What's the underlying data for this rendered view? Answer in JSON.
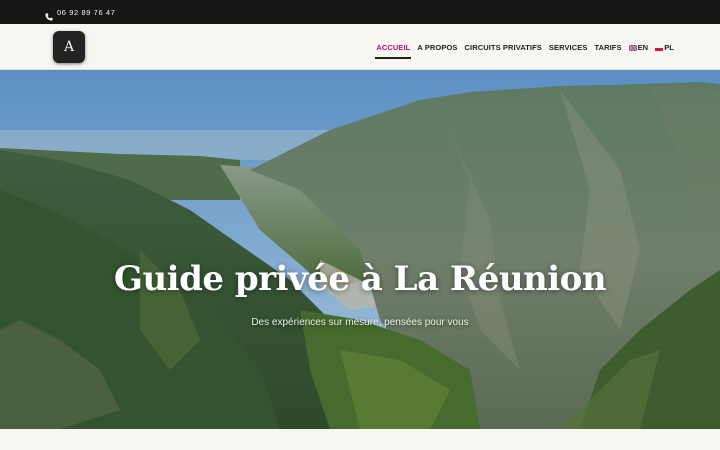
{
  "topbar": {
    "phone": "06 92 89 76 47",
    "icon": "phone-icon"
  },
  "header": {
    "logo_letter": "A",
    "nav": [
      {
        "label": "ACCUEIL",
        "active": true
      },
      {
        "label": "A PROPOS",
        "active": false
      },
      {
        "label": "CIRCUITS PRIVATIFS",
        "active": false
      },
      {
        "label": "SERVICES",
        "active": false
      },
      {
        "label": "TARIFS",
        "active": false
      },
      {
        "label": "EN",
        "flag": "uk-flag-icon",
        "active": false
      },
      {
        "label": "PL",
        "flag": "pl-flag-icon",
        "active": false
      }
    ]
  },
  "hero": {
    "title": "Guide privée à La Réunion",
    "subtitle": "Des expériences sur mesure, pensées pour vous"
  },
  "colors": {
    "accent": "#b3126e",
    "topbar": "#161616",
    "background": "#f8f6f1"
  }
}
